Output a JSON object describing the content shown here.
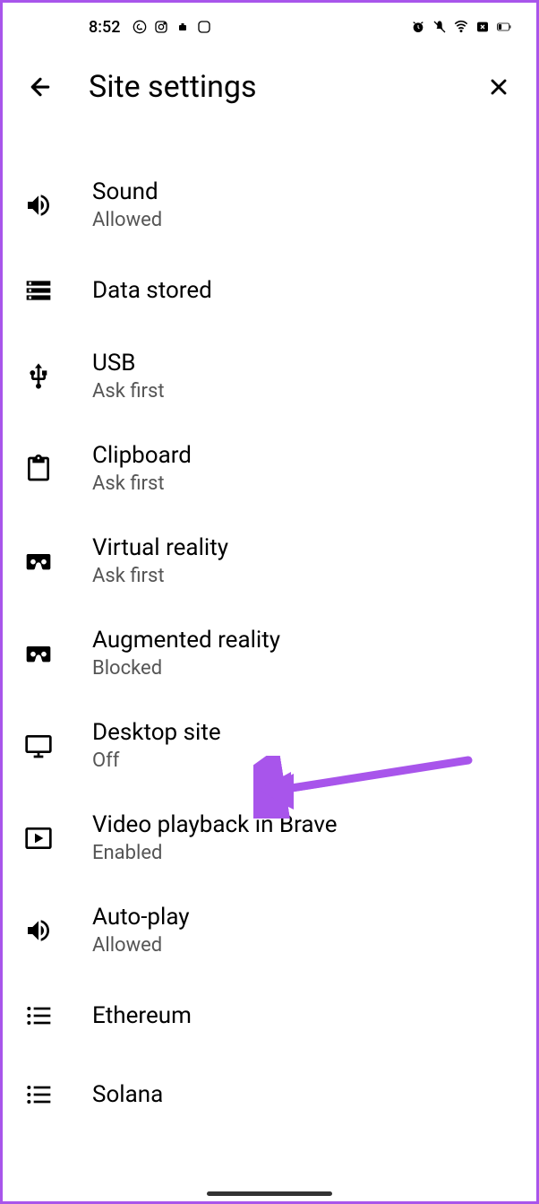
{
  "statusBar": {
    "time": "8:52"
  },
  "header": {
    "title": "Site settings"
  },
  "settings": {
    "sound": {
      "title": "Sound",
      "subtitle": "Allowed"
    },
    "dataStored": {
      "title": "Data stored"
    },
    "usb": {
      "title": "USB",
      "subtitle": "Ask first"
    },
    "clipboard": {
      "title": "Clipboard",
      "subtitle": "Ask first"
    },
    "vr": {
      "title": "Virtual reality",
      "subtitle": "Ask first"
    },
    "ar": {
      "title": "Augmented reality",
      "subtitle": "Blocked"
    },
    "desktopSite": {
      "title": "Desktop site",
      "subtitle": "Off"
    },
    "videoPlayback": {
      "title": "Video playback in Brave",
      "subtitle": "Enabled"
    },
    "autoPlay": {
      "title": "Auto-play",
      "subtitle": "Allowed"
    },
    "ethereum": {
      "title": "Ethereum"
    },
    "solana": {
      "title": "Solana"
    }
  },
  "annotation": {
    "color": "#a855eb"
  }
}
